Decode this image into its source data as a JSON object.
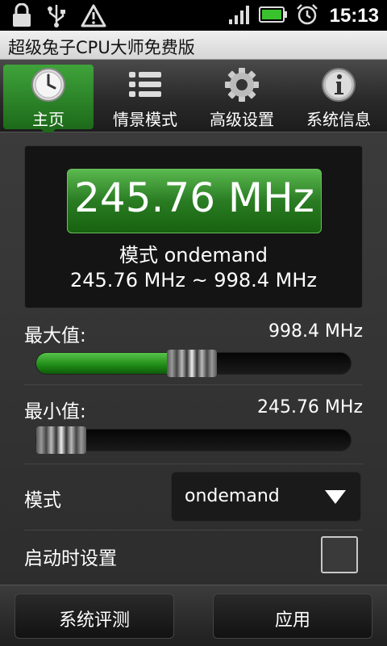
{
  "status_bar": {
    "time": "15:13",
    "icons": [
      "lock-icon",
      "usb-icon",
      "warning-icon",
      "signal-icon",
      "battery-icon",
      "alarm-icon"
    ]
  },
  "app": {
    "title": "超级兔子CPU大师免费版"
  },
  "tabs": [
    {
      "label": "主页",
      "icon": "clock-icon",
      "active": true
    },
    {
      "label": "情景模式",
      "icon": "list-icon",
      "active": false
    },
    {
      "label": "高级设置",
      "icon": "gear-icon",
      "active": false
    },
    {
      "label": "系统信息",
      "icon": "info-icon",
      "active": false
    }
  ],
  "info_panel": {
    "current_frequency": "245.76 MHz",
    "mode_line": "模式 ondemand",
    "range_line": "245.76 MHz ~ 998.4 MHz"
  },
  "max_setting": {
    "label": "最大值:",
    "value": "998.4 MHz",
    "slider_fraction": 0.49
  },
  "min_setting": {
    "label": "最小值:",
    "value": "245.76 MHz",
    "slider_fraction": 0.0
  },
  "mode_setting": {
    "label": "模式",
    "selected": "ondemand"
  },
  "boot_setting": {
    "label": "启动时设置",
    "checked": false
  },
  "buttons": {
    "benchmark": "系统评测",
    "apply": "应用"
  },
  "colors": {
    "accent_green": "#2a7c23",
    "background": "#333333"
  }
}
